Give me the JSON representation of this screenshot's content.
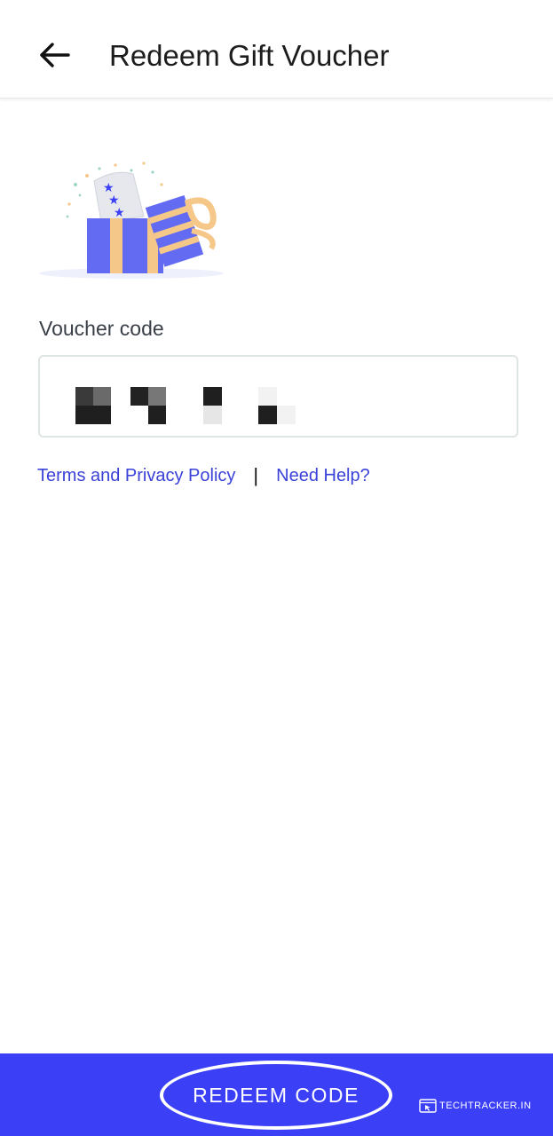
{
  "header": {
    "title": "Redeem Gift Voucher",
    "back_icon": "arrow-left-icon"
  },
  "illustration": {
    "icon": "gift-box-icon",
    "colors": {
      "box": "#636bf2",
      "ribbon": "#f5c88a",
      "ticket": "#e6e8ee",
      "stars": "#3b3ff6"
    }
  },
  "form": {
    "label": "Voucher code",
    "value_state": "pixelated / redacted"
  },
  "links": {
    "terms": "Terms and Privacy Policy",
    "separator": "|",
    "help": "Need Help?"
  },
  "footer": {
    "button_label": "REDEEM CODE",
    "watermark": "TECHTRACKER.IN",
    "watermark_icon": "browser-cursor-icon"
  },
  "colors": {
    "primary": "#3b3ff6",
    "link": "#3a42d8",
    "input_border": "#dfe5e3",
    "text": "#1c1c1c"
  }
}
